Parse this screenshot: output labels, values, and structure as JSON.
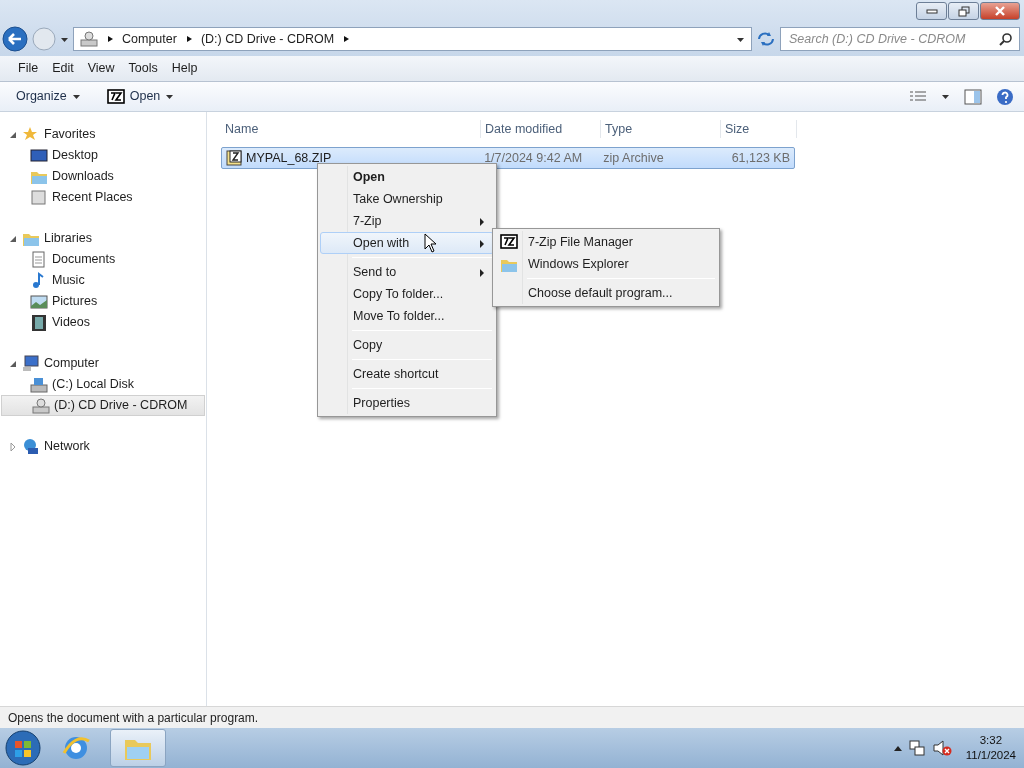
{
  "address_bar": {
    "crumbs": [
      "Computer",
      "(D:) CD Drive - CDROM"
    ]
  },
  "search": {
    "placeholder": "Search (D:) CD Drive - CDROM"
  },
  "menu_bar": [
    "File",
    "Edit",
    "View",
    "Tools",
    "Help"
  ],
  "command_bar": [
    {
      "label": "Organize",
      "kind": "plain"
    },
    {
      "label": "Open",
      "kind": "sevenzip"
    }
  ],
  "sidebar": {
    "groups": [
      {
        "label": "Favorites",
        "expanded": true,
        "selected": false,
        "children": [
          {
            "label": "Desktop",
            "selected": false
          },
          {
            "label": "Downloads",
            "selected": false
          },
          {
            "label": "Recent Places",
            "selected": false
          }
        ]
      },
      {
        "label": "Libraries",
        "expanded": true,
        "selected": false,
        "children": [
          {
            "label": "Documents",
            "selected": false
          },
          {
            "label": "Music",
            "selected": false
          },
          {
            "label": "Pictures",
            "selected": false
          },
          {
            "label": "Videos",
            "selected": false
          }
        ]
      },
      {
        "label": "Computer",
        "expanded": true,
        "selected": false,
        "children": [
          {
            "label": "(C:) Local Disk",
            "selected": false
          },
          {
            "label": "(D:) CD Drive - CDROM",
            "selected": true
          }
        ]
      },
      {
        "label": "Network",
        "expanded": false,
        "selected": false
      }
    ]
  },
  "table": {
    "columns": [
      "Name",
      "Date modified",
      "Type",
      "Size"
    ],
    "rows": [
      {
        "cells": [
          "MYPAL_68.ZIP",
          "1/7/2024 9:42 AM",
          "zip Archive",
          "61,123 KB"
        ],
        "selected": true
      }
    ]
  },
  "context_menu": {
    "items": [
      {
        "kind": "item",
        "label": "Open",
        "default": true,
        "submenu": false,
        "selected": false
      },
      {
        "kind": "item",
        "label": "Take Ownership",
        "default": false,
        "submenu": false,
        "selected": false
      },
      {
        "kind": "item",
        "label": "7-Zip",
        "default": false,
        "submenu": true,
        "selected": false
      },
      {
        "kind": "item",
        "label": "Open with",
        "default": false,
        "submenu": true,
        "selected": true
      },
      {
        "kind": "separator"
      },
      {
        "kind": "item",
        "label": "Send to",
        "default": false,
        "submenu": true,
        "selected": false
      },
      {
        "kind": "item",
        "label": "Copy To folder...",
        "default": false,
        "submenu": false,
        "selected": false
      },
      {
        "kind": "item",
        "label": "Move To folder...",
        "default": false,
        "submenu": false,
        "selected": false
      },
      {
        "kind": "separator"
      },
      {
        "kind": "item",
        "label": "Copy",
        "default": false,
        "submenu": false,
        "selected": false
      },
      {
        "kind": "separator"
      },
      {
        "kind": "item",
        "label": "Create shortcut",
        "default": false,
        "submenu": false,
        "selected": false
      },
      {
        "kind": "separator"
      },
      {
        "kind": "item",
        "label": "Properties",
        "default": false,
        "submenu": false,
        "selected": false
      }
    ]
  },
  "submenu": {
    "items": [
      {
        "kind": "sevenzip",
        "label": "7-Zip File Manager"
      },
      {
        "kind": "explorer",
        "label": "Windows Explorer"
      },
      {
        "kind": "separator"
      },
      {
        "kind": "item",
        "label": "Choose default program..."
      }
    ]
  },
  "status_bar": {
    "text": "Opens the document with a particular program."
  },
  "taskbar": {
    "apps": [
      {
        "kind": "ie",
        "selected": false
      },
      {
        "kind": "explorer",
        "selected": true
      }
    ],
    "clock": {
      "time": "3:32",
      "date": "11/1/2024"
    }
  }
}
